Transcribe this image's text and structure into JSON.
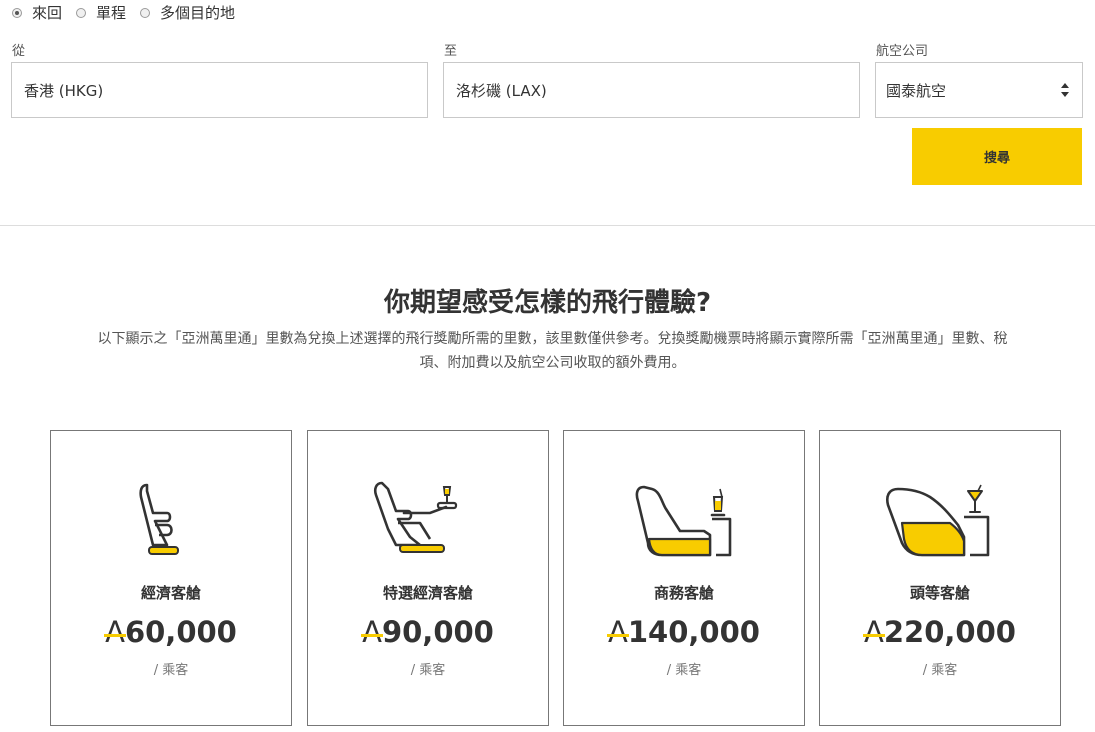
{
  "trip_type": {
    "options": [
      {
        "label": "來回",
        "selected": true
      },
      {
        "label": "單程",
        "selected": false
      },
      {
        "label": "多個目的地",
        "selected": false
      }
    ]
  },
  "form": {
    "from": {
      "label": "從",
      "value": "香港 (HKG)"
    },
    "to": {
      "label": "至",
      "value": "洛杉磯 (LAX)"
    },
    "airline": {
      "label": "航空公司",
      "value": "國泰航空"
    },
    "search_label": "搜尋"
  },
  "section": {
    "heading": "你期望感受怎樣的飛行體驗?",
    "intro": "以下顯示之「亞洲萬里通」里數為兌換上述選擇的飛行獎勵所需的里數，該里數僅供參考。兌換獎勵機票時將顯示實際所需「亞洲萬里通」里數、稅項、附加費以及航空公司收取的額外費用。"
  },
  "currency_symbol": "A",
  "cabins": [
    {
      "name": "經濟客艙",
      "miles": "60,000",
      "per": "/ 乘客",
      "icon": "economy-seat-icon"
    },
    {
      "name": "特選經濟客艙",
      "miles": "90,000",
      "per": "/ 乘客",
      "icon": "premium-economy-seat-icon"
    },
    {
      "name": "商務客艙",
      "miles": "140,000",
      "per": "/ 乘客",
      "icon": "business-seat-icon"
    },
    {
      "name": "頭等客艙",
      "miles": "220,000",
      "per": "/ 乘客",
      "icon": "first-class-seat-icon"
    }
  ],
  "colors": {
    "accent": "#f8cc00",
    "icon_stroke": "#333333"
  }
}
